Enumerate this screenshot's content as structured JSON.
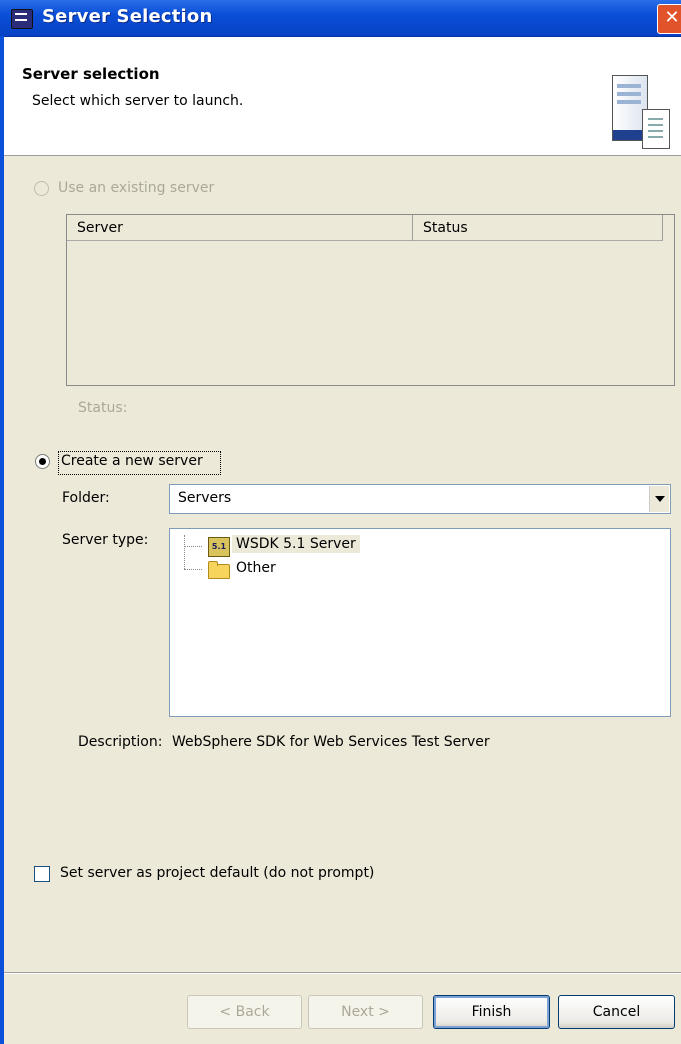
{
  "window": {
    "title": "Server Selection",
    "close_glyph": "✕"
  },
  "header": {
    "title": "Server selection",
    "description": "Select which server to launch."
  },
  "existing": {
    "radio_label": "Use an existing server",
    "table_columns": [
      "Server",
      "Status"
    ],
    "status_label": "Status:"
  },
  "create": {
    "radio_label": "Create a new server",
    "folder_label": "Folder:",
    "folder_value": "Servers",
    "server_type_label": "Server type:",
    "tree_items": [
      {
        "label": "WSDK 5.1 Server",
        "icon": "wsdk-server-icon",
        "icon_text": "5.1"
      },
      {
        "label": "Other",
        "icon": "folder-icon"
      }
    ],
    "description_label": "Description:",
    "description_value": "WebSphere SDK for Web Services Test Server"
  },
  "default_checkbox": {
    "label": "Set server as project default (do not prompt)"
  },
  "buttons": {
    "back": "< Back",
    "next": "Next >",
    "finish": "Finish",
    "cancel": "Cancel"
  }
}
